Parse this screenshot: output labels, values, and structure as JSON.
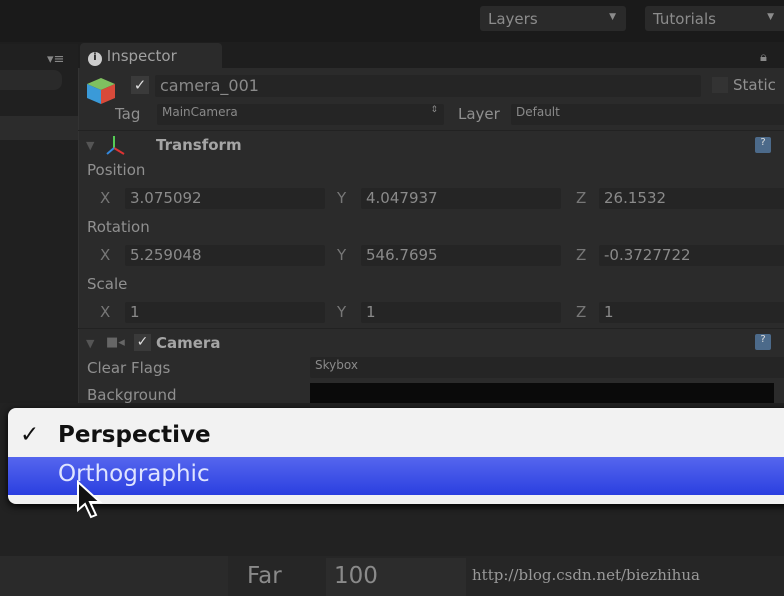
{
  "toolbar": {
    "layers": "Layers",
    "tutorials": "Tutorials"
  },
  "inspector": {
    "tab": "Inspector",
    "object_name": "camera_001",
    "active": true,
    "static_label": "Static",
    "tag_label": "Tag",
    "tag_value": "MainCamera",
    "layer_label": "Layer",
    "layer_value": "Default",
    "transform": {
      "title": "Transform",
      "position": {
        "label": "Position",
        "x": "3.075092",
        "y": "4.047937",
        "z": "26.1532"
      },
      "rotation": {
        "label": "Rotation",
        "x": "5.259048",
        "y": "546.7695",
        "z": "-0.3727722"
      },
      "scale": {
        "label": "Scale",
        "x": "1",
        "y": "1",
        "z": "1"
      },
      "axes": {
        "x": "X",
        "y": "Y",
        "z": "Z"
      }
    },
    "camera": {
      "title": "Camera",
      "enabled": true,
      "clear_flags_label": "Clear Flags",
      "clear_flags_value": "Skybox",
      "background_label": "Background",
      "background_color": "#0a0a0a"
    }
  },
  "projection_menu": {
    "check": "✓",
    "options": [
      {
        "label": "Perspective",
        "checked": true
      },
      {
        "label": "Orthographic",
        "highlighted": true
      }
    ],
    "highlight_color": "#3a4ce0"
  },
  "clipping": {
    "far_label": "Far",
    "far_value": "100"
  },
  "watermark": "http://blog.csdn.net/biezhihua"
}
